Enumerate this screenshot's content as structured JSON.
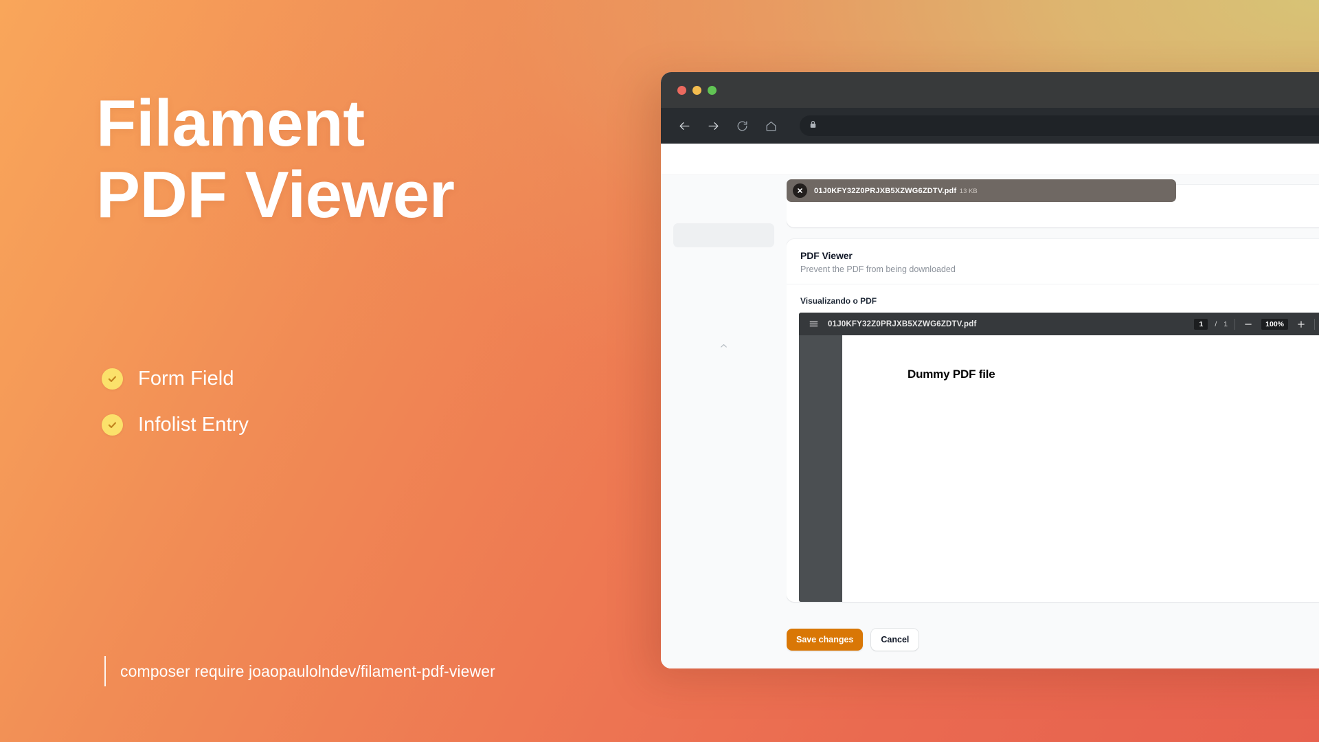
{
  "theme": {
    "gradient_from": "#f9a65a",
    "gradient_to": "#e7614e",
    "accent_yellow": "#fbe16b",
    "accent_orange": "#d97706"
  },
  "promo": {
    "headline_line1": "Filament",
    "headline_line2": "PDF Viewer",
    "features": [
      {
        "label": "Form Field",
        "icon": "check-circle-icon"
      },
      {
        "label": "Infolist Entry",
        "icon": "check-circle-icon"
      }
    ],
    "composer_command": "composer require joaopaulolndev/filament-pdf-viewer"
  },
  "browser": {
    "traffic_lights": [
      "close",
      "minimize",
      "maximize"
    ],
    "nav": {
      "back": "back-icon",
      "forward": "forward-icon",
      "reload": "reload-icon",
      "home": "home-icon"
    },
    "address": {
      "lock": "lock-icon",
      "url": "",
      "placeholder": ""
    }
  },
  "app": {
    "sidebar": {
      "collapse_icon": "chevron-up-icon"
    },
    "upload": {
      "file_name": "01J0KFY32Z0PRJXB5XZWG6ZDTV.pdf",
      "file_size": "13 KB",
      "remove_icon": "close-icon"
    },
    "viewer_section": {
      "title": "PDF Viewer",
      "subtitle": "Prevent the PDF from being downloaded",
      "field_label": "Visualizando o PDF"
    },
    "pdf": {
      "menu_icon": "hamburger-menu-icon",
      "file_name": "01J0KFY32Z0PRJXB5XZWG6ZDTV.pdf",
      "page_current": "1",
      "page_separator": "/",
      "page_total": "1",
      "zoom_out_icon": "minus-icon",
      "zoom_level": "100%",
      "zoom_in_icon": "plus-icon",
      "fit_icon": "fit-page-icon",
      "rotate_icon": "rotate-icon",
      "page_text": "Dummy PDF file"
    },
    "actions": {
      "save_label": "Save changes",
      "cancel_label": "Cancel"
    }
  }
}
